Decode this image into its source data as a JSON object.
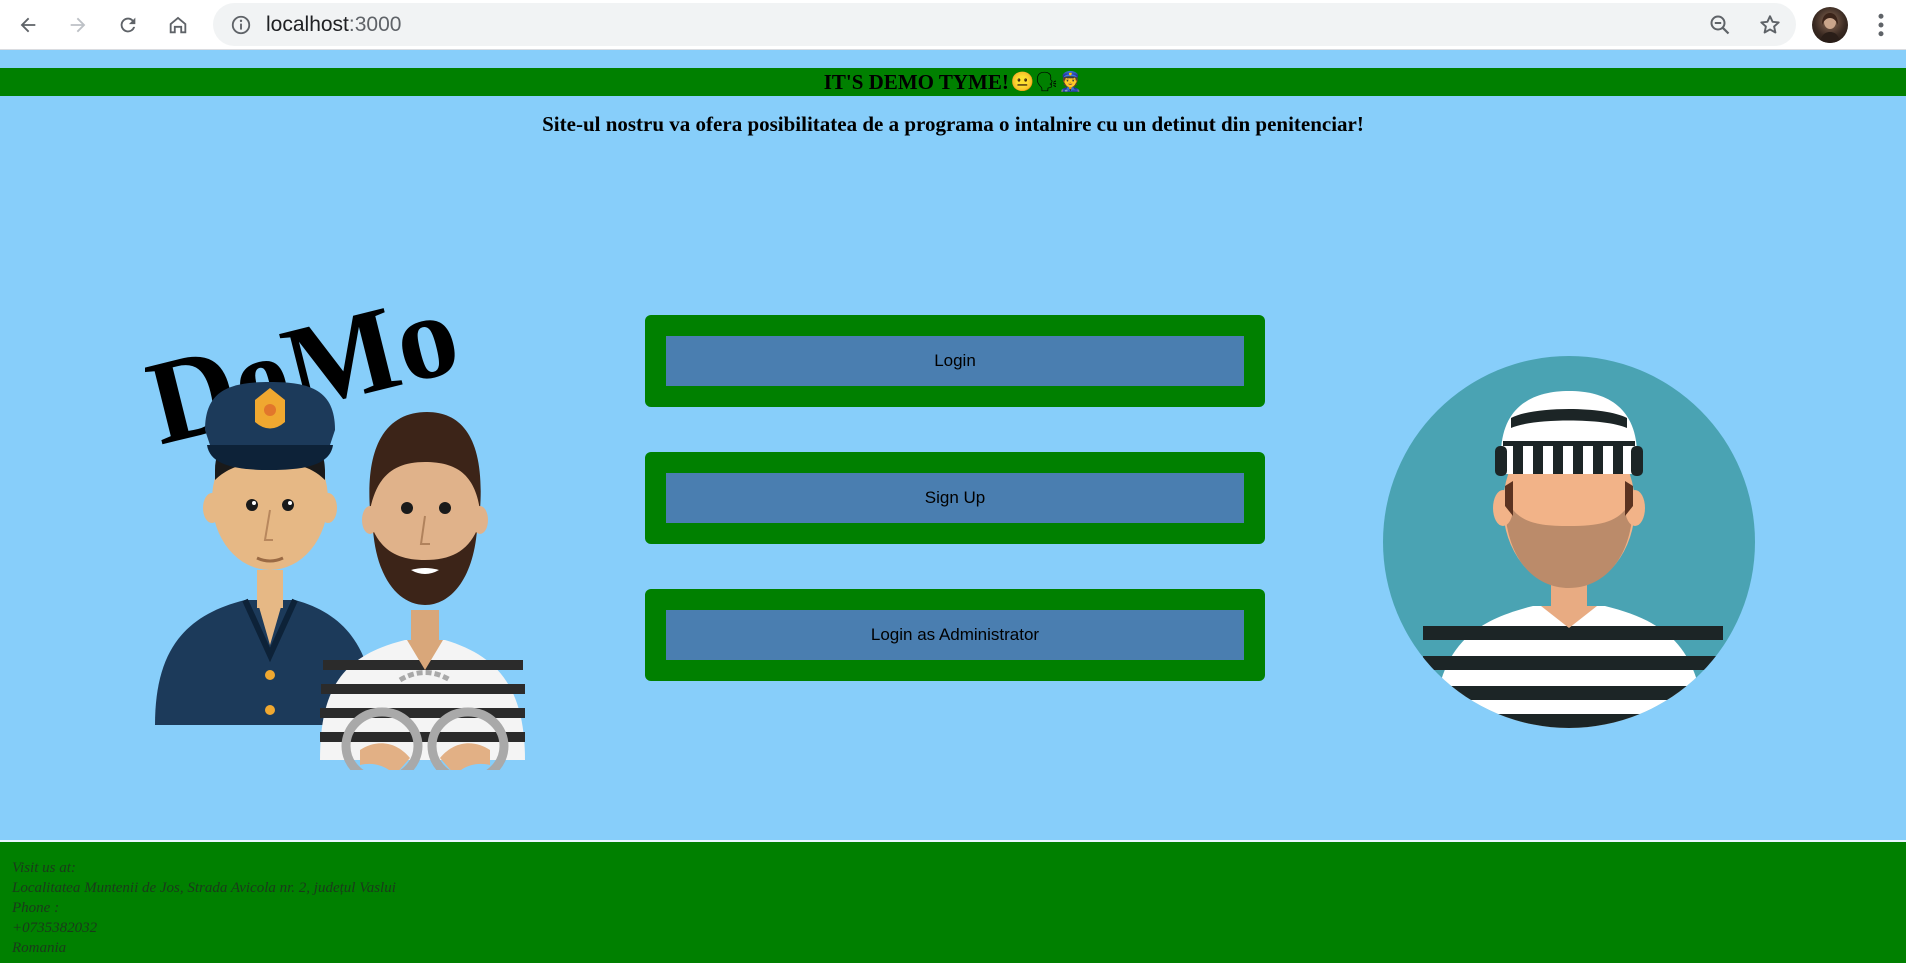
{
  "browser": {
    "url_host": "localhost",
    "url_port": ":3000",
    "icons": [
      "back-arrow-icon",
      "forward-arrow-icon",
      "reload-icon",
      "home-icon",
      "info-icon",
      "zoom-out-icon",
      "star-icon",
      "profile-avatar",
      "menu-dots-icon"
    ]
  },
  "banner": {
    "text": "IT'S DEMO TYME!",
    "emojis": "😐🗣👮"
  },
  "subtitle": "Site-ul nostru va ofera posibilitatea de a programa o intalnire cu un detinut din penitenciar!",
  "logo": {
    "text": "DeMo"
  },
  "buttons": {
    "login": "Login",
    "signup": "Sign Up",
    "admin": "Login as Administrator"
  },
  "footer": {
    "lines": [
      "Visit us at:",
      "Localitatea Muntenii de Jos, Strada Avicola nr. 2, județul Vaslui",
      "Phone :",
      "+0735382032",
      "Romania"
    ]
  },
  "colors": {
    "page_bg": "#87cefa",
    "banner_green": "#008000",
    "button_fill": "#4a7eb0",
    "avatar_circle": "#4aa3b3"
  }
}
